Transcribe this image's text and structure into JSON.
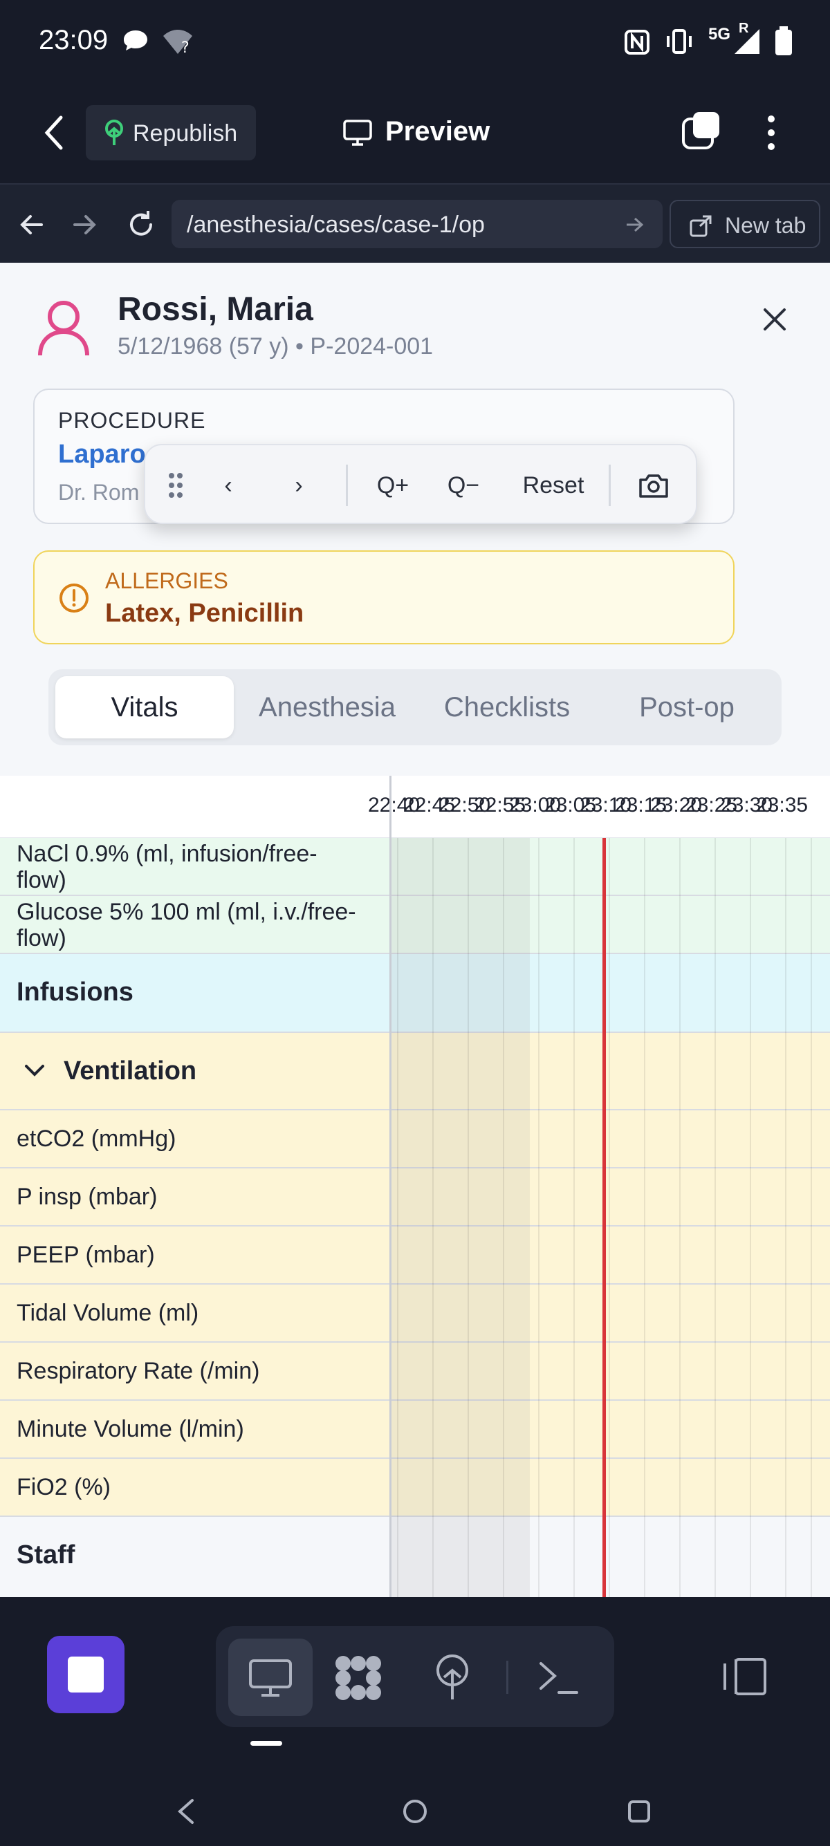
{
  "status_bar": {
    "time": "23:09",
    "network": "5G",
    "network_sup": "R"
  },
  "app_bar": {
    "republish_label": "Republish",
    "preview_label": "Preview"
  },
  "url_bar": {
    "url": "/anesthesia/cases/case-1/op",
    "new_tab_label": "New tab"
  },
  "patient": {
    "name": "Rossi, Maria",
    "meta": "5/12/1968 (57 y) • P-2024-001"
  },
  "procedure": {
    "label": "PROCEDURE",
    "name_visible": "Laparo",
    "surgeon_visible": "Dr. Rom"
  },
  "allergies": {
    "label": "ALLERGIES",
    "value": "Latex, Penicillin"
  },
  "tabs": [
    {
      "label": "Vitals",
      "active": true
    },
    {
      "label": "Anesthesia",
      "active": false
    },
    {
      "label": "Checklists",
      "active": false
    },
    {
      "label": "Post-op",
      "active": false
    }
  ],
  "toolbar": {
    "prev": "‹",
    "next": "›",
    "zoom_in": "Q+",
    "zoom_out": "Q−",
    "reset": "Reset"
  },
  "time_axis": [
    "22:40",
    "22:45",
    "22:50",
    "22:55",
    "23:00",
    "23:05",
    "23:10",
    "23:15",
    "23:20",
    "23:25",
    "23:30",
    "23:35"
  ],
  "rows": [
    {
      "label": "NaCl 0.9% (ml, infusion/free-flow)",
      "type": "fluid"
    },
    {
      "label": "Glucose 5% 100 ml (ml, i.v./free-flow)",
      "type": "fluid"
    },
    {
      "label": "Infusions",
      "type": "section-infusions"
    },
    {
      "label": "Ventilation",
      "type": "section-ventilation"
    },
    {
      "label": "etCO2 (mmHg)",
      "type": "vent"
    },
    {
      "label": "P insp (mbar)",
      "type": "vent"
    },
    {
      "label": "PEEP (mbar)",
      "type": "vent"
    },
    {
      "label": "Tidal Volume (ml)",
      "type": "vent"
    },
    {
      "label": "Respiratory Rate (/min)",
      "type": "vent"
    },
    {
      "label": "Minute Volume (l/min)",
      "type": "vent"
    },
    {
      "label": "FiO2 (%)",
      "type": "vent"
    },
    {
      "label": "Staff",
      "type": "section-staff"
    }
  ],
  "colors": {
    "fluid_bg": "#e9f9ee",
    "infusions_bg": "#e0f7fb",
    "vent_bg": "#fdf5d6",
    "staff_bg": "#f5f7fa",
    "now_line": "#d8343a",
    "accent": "#5b3fd8"
  }
}
